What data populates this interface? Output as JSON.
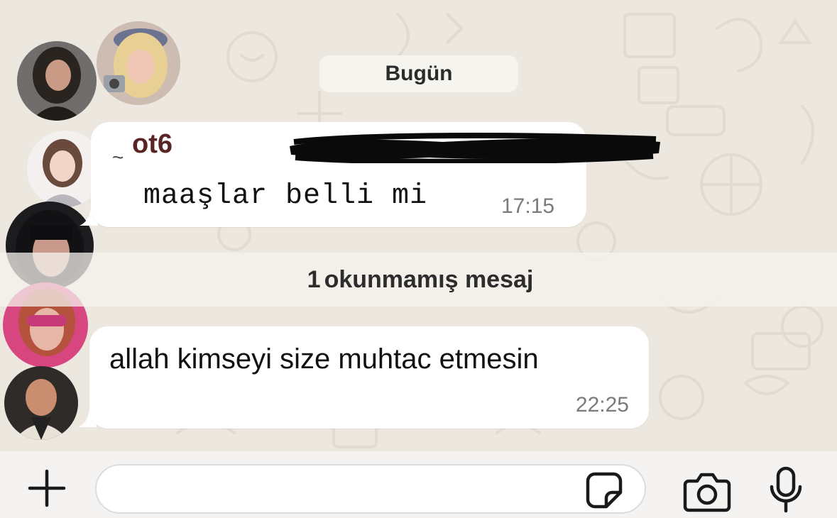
{
  "chat": {
    "date_chip": "Bugün",
    "message1": {
      "sender_prefix": "~",
      "sender": "ot6",
      "text": "maaşlar belli mi",
      "time": "17:15"
    },
    "unread_count": "1",
    "unread_label": "okunmamış mesaj",
    "message2": {
      "text": "allah kimseyi size muhtac etmesin",
      "time": "22:25"
    }
  },
  "input": {
    "value": "",
    "placeholder": ""
  },
  "icons": {
    "attach": "plus-icon",
    "sticker": "sticker-icon",
    "camera": "camera-icon",
    "mic": "microphone-icon"
  },
  "colors": {
    "chat_background": "#ece7df",
    "bubble": "#ffffff",
    "sender_name": "#5a2424",
    "timestamp": "#7b7b7b"
  }
}
